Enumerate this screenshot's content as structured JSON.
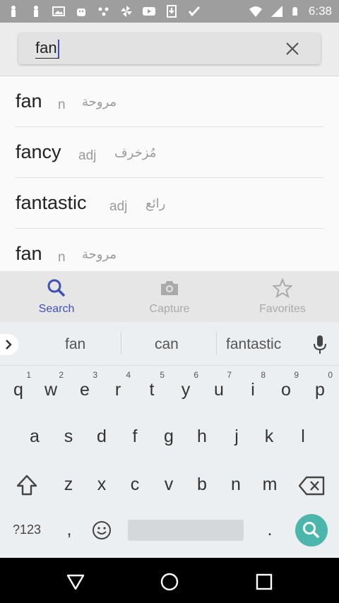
{
  "status_bar": {
    "time": "6:38",
    "icons": [
      "notification-person-icon",
      "notification-person-icon",
      "image-icon",
      "android-icon",
      "dots-icon",
      "pinwheel-icon",
      "youtube-icon",
      "download-icon",
      "check-icon",
      "wifi-icon",
      "signal-icon",
      "battery-icon"
    ]
  },
  "search": {
    "query": "fan"
  },
  "results": [
    {
      "word": "fan",
      "pos": "n",
      "translation": "مروحة"
    },
    {
      "word": "fancy",
      "pos": "adj",
      "translation": "مُزخرف"
    },
    {
      "word": "fantastic",
      "pos": "adj",
      "translation": "رائع"
    },
    {
      "word": "fan",
      "pos": "n",
      "translation": "مروحة"
    }
  ],
  "tabs": [
    {
      "label": "Search",
      "icon": "search-icon",
      "active": true
    },
    {
      "label": "Capture",
      "icon": "camera-icon",
      "active": false
    },
    {
      "label": "Favorites",
      "icon": "star-icon",
      "active": false
    }
  ],
  "suggestions": [
    "fan",
    "can",
    "fantastic"
  ],
  "keyboard": {
    "row1": [
      {
        "k": "q",
        "h": "1"
      },
      {
        "k": "w",
        "h": "2"
      },
      {
        "k": "e",
        "h": "3"
      },
      {
        "k": "r",
        "h": "4"
      },
      {
        "k": "t",
        "h": "5"
      },
      {
        "k": "y",
        "h": "6"
      },
      {
        "k": "u",
        "h": "7"
      },
      {
        "k": "i",
        "h": "8"
      },
      {
        "k": "o",
        "h": "9"
      },
      {
        "k": "p",
        "h": "0"
      }
    ],
    "row2": [
      "a",
      "s",
      "d",
      "f",
      "g",
      "h",
      "j",
      "k",
      "l"
    ],
    "row3": [
      "z",
      "x",
      "c",
      "v",
      "b",
      "n",
      "m"
    ],
    "symbols_label": "?123",
    "comma": ",",
    "period": "."
  },
  "colors": {
    "accent": "#3f51b5",
    "enter_key": "#4db6ac",
    "status_bar": "#9e9e9e"
  }
}
